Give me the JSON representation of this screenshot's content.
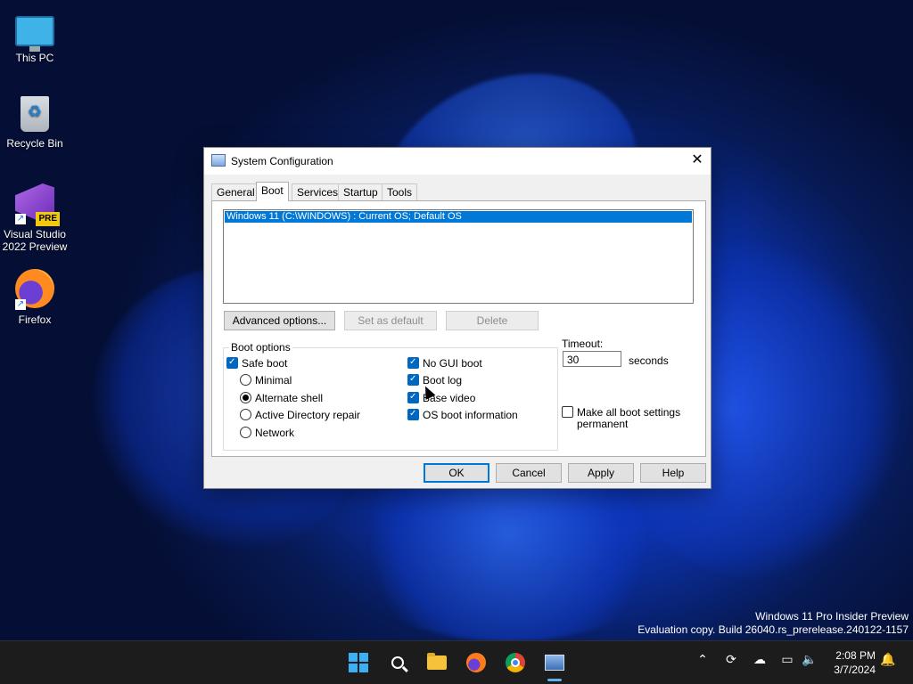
{
  "desktop": {
    "icons": [
      {
        "label": "This PC"
      },
      {
        "label": "Recycle Bin"
      },
      {
        "label": "Visual Studio 2022 Preview",
        "badge": "PRE"
      },
      {
        "label": "Firefox"
      }
    ]
  },
  "dialog": {
    "title": "System Configuration",
    "close_glyph": "✕",
    "tabs": [
      {
        "label": "General"
      },
      {
        "label": "Boot",
        "active": true
      },
      {
        "label": "Services"
      },
      {
        "label": "Startup"
      },
      {
        "label": "Tools"
      }
    ],
    "os_list": [
      "Windows 11 (C:\\WINDOWS) : Current OS; Default OS"
    ],
    "buttons": {
      "advanced": "Advanced options...",
      "set_default": "Set as default",
      "delete": "Delete"
    },
    "boot_options": {
      "label": "Boot options",
      "safe_boot": {
        "label": "Safe boot",
        "checked": true
      },
      "minimal": {
        "label": "Minimal",
        "selected": false
      },
      "alternate_shell": {
        "label": "Alternate shell",
        "selected": true
      },
      "ad_repair": {
        "label": "Active Directory repair",
        "selected": false
      },
      "network": {
        "label": "Network",
        "selected": false
      },
      "no_gui_boot": {
        "label": "No GUI boot",
        "checked": true
      },
      "boot_log": {
        "label": "Boot log",
        "checked": true
      },
      "base_video": {
        "label": "Base video",
        "checked": true
      },
      "os_boot_info": {
        "label": "OS boot information",
        "checked": true
      }
    },
    "timeout": {
      "label": "Timeout:",
      "value": "30",
      "unit": "seconds"
    },
    "make_permanent": {
      "label_line1": "Make all boot settings",
      "label_line2": "permanent",
      "checked": false
    },
    "footer": {
      "ok": "OK",
      "cancel": "Cancel",
      "apply": "Apply",
      "help": "Help"
    }
  },
  "watermark": {
    "line1": "Windows 11 Pro Insider Preview",
    "line2": "Evaluation copy. Build 26040.rs_prerelease.240122-1157"
  },
  "taskbar": {
    "apps": [
      "start",
      "search",
      "file-explorer",
      "firefox",
      "chrome",
      "system-configuration"
    ],
    "time": "2:08 PM",
    "date": "3/7/2024"
  },
  "colors": {
    "accent": "#0078d7",
    "taskbar": "#1c1c1c"
  }
}
